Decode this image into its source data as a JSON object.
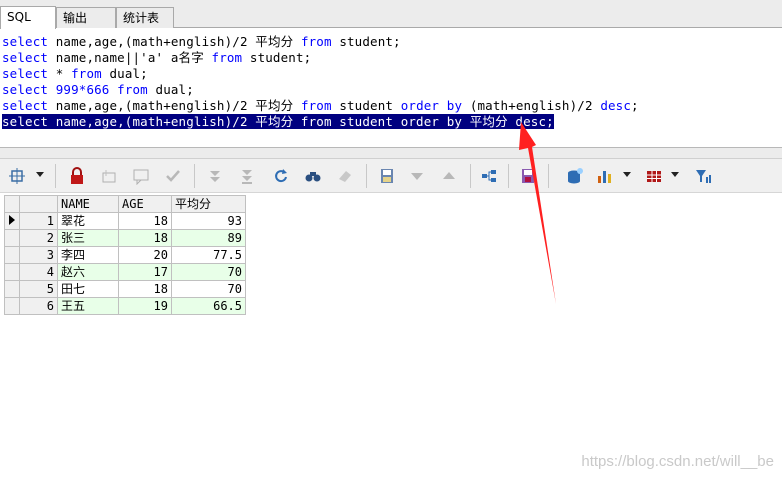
{
  "tabs": [
    {
      "label": "SQL"
    },
    {
      "label": "输出"
    },
    {
      "label": "统计表"
    }
  ],
  "editor": {
    "lines": [
      [
        {
          "t": "select",
          "c": "kw"
        },
        {
          "t": " name,age,(math+english)/2 平均分 ",
          "c": "plain"
        },
        {
          "t": "from",
          "c": "kw"
        },
        {
          "t": " student;",
          "c": "plain"
        }
      ],
      [
        {
          "t": "select",
          "c": "kw"
        },
        {
          "t": " name,name||'a' a名字 ",
          "c": "plain"
        },
        {
          "t": "from",
          "c": "kw"
        },
        {
          "t": " student;",
          "c": "plain"
        }
      ],
      [
        {
          "t": "select",
          "c": "kw"
        },
        {
          "t": " * ",
          "c": "plain"
        },
        {
          "t": "from",
          "c": "kw"
        },
        {
          "t": " dual;",
          "c": "plain"
        }
      ],
      [
        {
          "t": "select",
          "c": "kw"
        },
        {
          "t": " 999*666 ",
          "c": "num"
        },
        {
          "t": "from",
          "c": "kw"
        },
        {
          "t": " dual;",
          "c": "plain"
        }
      ],
      [
        {
          "t": "select",
          "c": "kw"
        },
        {
          "t": " name,age,(math+english)/2 平均分 ",
          "c": "plain"
        },
        {
          "t": "from",
          "c": "kw"
        },
        {
          "t": " student ",
          "c": "plain"
        },
        {
          "t": "order by",
          "c": "kw"
        },
        {
          "t": " (math+english)/2 ",
          "c": "plain"
        },
        {
          "t": "desc",
          "c": "kw"
        },
        {
          "t": ";",
          "c": "plain"
        }
      ],
      [
        {
          "t": "select name,age,(math+english)/2 平均分 from student order by 平均分 desc;",
          "c": "sel"
        }
      ]
    ]
  },
  "toolbar": {
    "icons": [
      "grid-options-icon",
      "lock-icon",
      "new-record-icon",
      "comment-icon",
      "check-icon",
      "first-record-icon",
      "last-record-icon",
      "refresh-icon",
      "find-icon",
      "clear-icon",
      "save-file-icon",
      "down-icon",
      "up-icon",
      "tree-icon",
      "save-icon",
      "db-icon",
      "chart-icon",
      "table-icon",
      "filter-icon"
    ]
  },
  "grid": {
    "columns": [
      "NAME",
      "AGE",
      "平均分"
    ],
    "rows": [
      {
        "n": "1",
        "name": "翠花",
        "age": "18",
        "avg": "93"
      },
      {
        "n": "2",
        "name": "张三",
        "age": "18",
        "avg": "89"
      },
      {
        "n": "3",
        "name": "李四",
        "age": "20",
        "avg": "77.5"
      },
      {
        "n": "4",
        "name": "赵六",
        "age": "17",
        "avg": "70"
      },
      {
        "n": "5",
        "name": "田七",
        "age": "18",
        "avg": "70"
      },
      {
        "n": "6",
        "name": "王五",
        "age": "19",
        "avg": "66.5"
      }
    ]
  },
  "watermark": "https://blog.csdn.net/will__be",
  "colors": {
    "keyword": "#0000ff",
    "selection": "#000080",
    "arrow": "#ff2020",
    "alt_row": "#e8ffe8"
  }
}
